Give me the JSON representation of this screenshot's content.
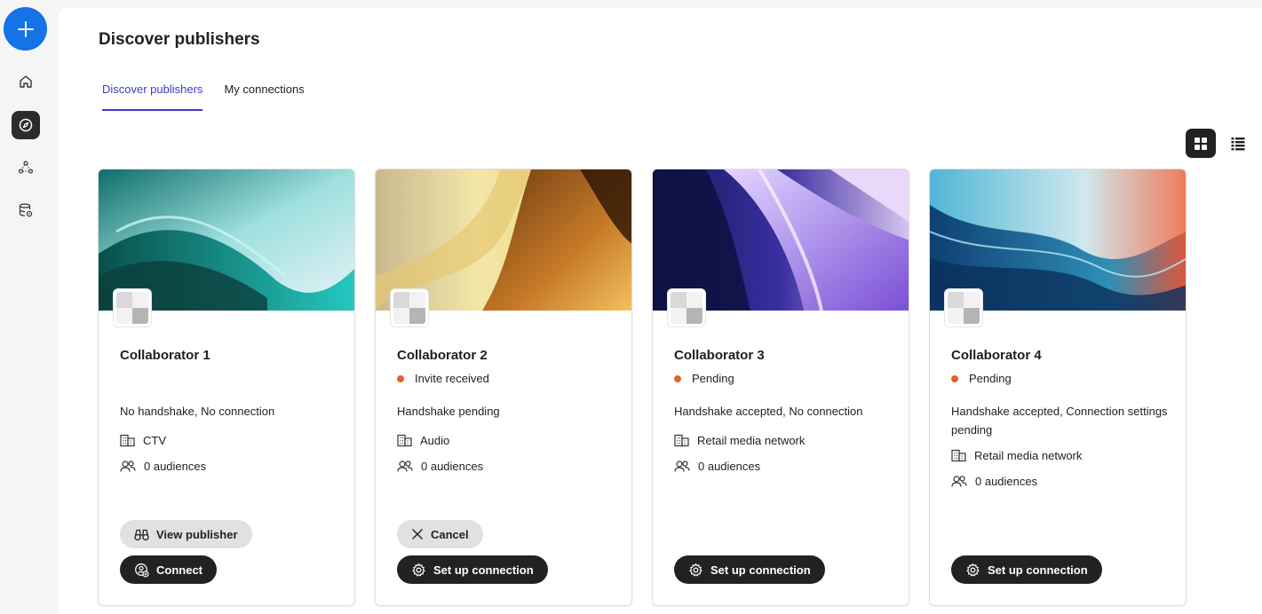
{
  "page": {
    "title": "Discover publishers"
  },
  "tabs": [
    {
      "label": "Discover publishers",
      "active": true
    },
    {
      "label": "My connections",
      "active": false
    }
  ],
  "view_toggle": {
    "grid_icon": "grid-view-icon",
    "list_icon": "list-view-icon",
    "selected": "grid"
  },
  "nav": {
    "create_icon": "plus-icon",
    "items": [
      {
        "icon": "home-icon",
        "active": false
      },
      {
        "icon": "discover-icon",
        "active": true
      },
      {
        "icon": "collaborators-icon",
        "active": false
      },
      {
        "icon": "data-settings-icon",
        "active": false
      }
    ]
  },
  "cards": [
    {
      "name": "Collaborator 1",
      "status": "",
      "handshake": "No handshake, No connection",
      "type": "CTV",
      "audiences": "0 audiences",
      "secondary_button": "View publisher",
      "primary_button": "Connect"
    },
    {
      "name": "Collaborator 2",
      "status": "Invite received",
      "handshake": "Handshake pending",
      "type": "Audio",
      "audiences": "0 audiences",
      "secondary_button": "Cancel",
      "primary_button": "Set up connection"
    },
    {
      "name": "Collaborator 3",
      "status": "Pending",
      "handshake": "Handshake accepted, No connection",
      "type": "Retail media network",
      "audiences": "0 audiences",
      "primary_button": "Set up connection"
    },
    {
      "name": "Collaborator 4",
      "status": "Pending",
      "handshake": "Handshake accepted, Connection settings pending",
      "type": "Retail media network",
      "audiences": "0 audiences",
      "primary_button": "Set up connection"
    }
  ],
  "colors": {
    "accent": "#1473e6",
    "tab_active": "#3d3dc4",
    "status_dot": "#e0642a",
    "dark_button": "#222222"
  }
}
